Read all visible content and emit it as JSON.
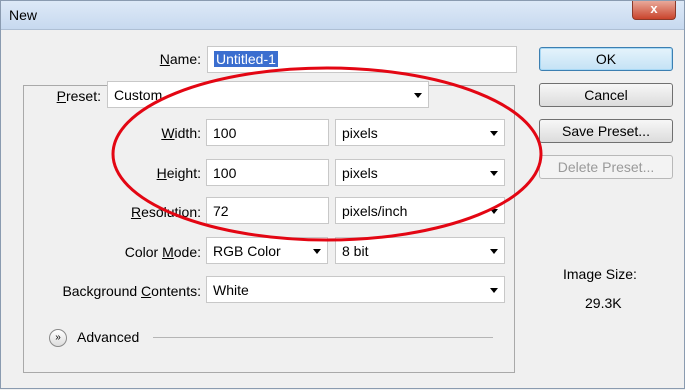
{
  "window": {
    "title": "New",
    "close_label": "x"
  },
  "form": {
    "name": {
      "label": "Name:",
      "value": "Untitled-1"
    },
    "preset": {
      "label": "Preset:",
      "value": "Custom"
    },
    "width": {
      "label": "Width:",
      "value": "100",
      "unit": "pixels"
    },
    "height": {
      "label": "Height:",
      "value": "100",
      "unit": "pixels"
    },
    "resolution": {
      "label": "Resolution:",
      "value": "72",
      "unit": "pixels/inch"
    },
    "color_mode": {
      "label": "Color Mode:",
      "value": "RGB Color",
      "depth": "8 bit"
    },
    "background": {
      "label": "Background Contents:",
      "value": "White"
    },
    "advanced_label": "Advanced"
  },
  "buttons": {
    "ok": "OK",
    "cancel": "Cancel",
    "save_preset": "Save Preset...",
    "delete_preset": "Delete Preset..."
  },
  "image_size": {
    "label": "Image Size:",
    "value": "29.3K"
  },
  "colors": {
    "annotation": "#e30613",
    "selection": "#3b6ecf"
  }
}
